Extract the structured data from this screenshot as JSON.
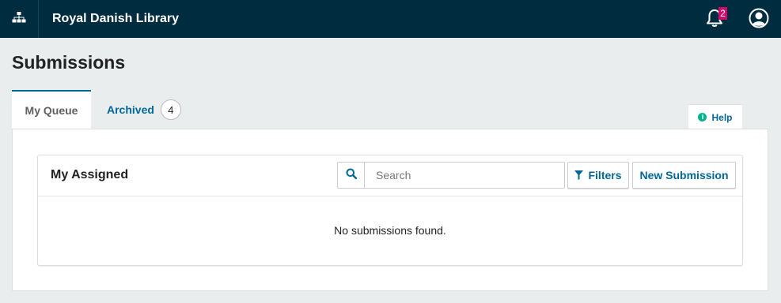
{
  "header": {
    "site_title": "Royal Danish Library",
    "sitemap_icon": "sitemap-icon",
    "notifications": {
      "icon": "bell-icon",
      "count": "2"
    },
    "user_icon": "user-circle-icon"
  },
  "page": {
    "title": "Submissions"
  },
  "tabs": [
    {
      "label": "My Queue",
      "active": true
    },
    {
      "label": "Archived",
      "count": "4",
      "active": false
    }
  ],
  "help": {
    "label": "Help",
    "icon": "info-icon",
    "icon_glyph": "i"
  },
  "list": {
    "title": "My Assigned",
    "search": {
      "placeholder": "Search",
      "value": "",
      "icon": "search-icon"
    },
    "filters_label": "Filters",
    "filters_icon": "filter-icon",
    "new_submission_label": "New Submission",
    "empty_message": "No submissions found."
  },
  "colors": {
    "topbar_bg": "#002c40",
    "link": "#006798",
    "badge": "#d00a6c",
    "help_icon": "#00b28d",
    "page_bg": "#eaedee"
  }
}
